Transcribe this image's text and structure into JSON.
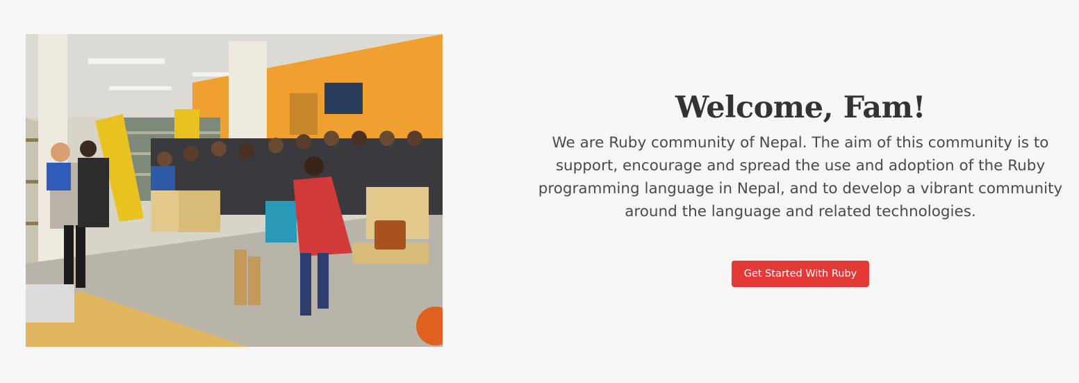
{
  "hero": {
    "title": "Welcome, Fam!",
    "description": "We are Ruby community of Nepal. The aim of this community is to support, encourage and spread the use and adoption of the Ruby programming language in Nepal, and to develop a vibrant community around the language and related technologies.",
    "cta_label": "Get Started With Ruby",
    "accent_color": "#e53935"
  },
  "photo": {
    "subject": "community-meetup-photo"
  }
}
